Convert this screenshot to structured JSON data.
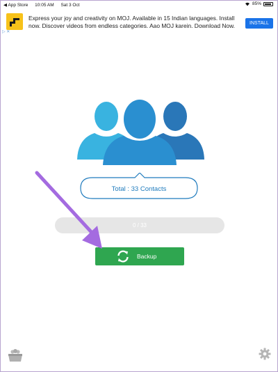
{
  "status_bar": {
    "back_label": "◀ App Store",
    "time": "10:05 AM",
    "date": "Sat 3 Oct",
    "battery": "85%",
    "battery_level": 0.85
  },
  "ad": {
    "text": "Express your joy and creativity on MOJ. Available in 15 Indian languages. Install now. Discover videos from endless categories. Aao MOJ karein. Download Now.",
    "install_label": "INSTALL",
    "badges": "▷ ✕"
  },
  "summary": {
    "total_label": "Total : 33 Contacts"
  },
  "progress": {
    "text": "0 / 33",
    "value": 0
  },
  "backup": {
    "label": "Backup"
  },
  "colors": {
    "person_left": "#39b3e0",
    "person_center": "#2a8fd0",
    "person_right": "#2a77b8",
    "accent_text": "#1f7bbd",
    "button_green": "#2fa650",
    "annotation_arrow": "#a46be0"
  },
  "icons": {
    "people": "contacts-group-icon",
    "sync": "sync-icon",
    "settings": "gear-icon",
    "bottom_left": "contacts-box-icon"
  }
}
